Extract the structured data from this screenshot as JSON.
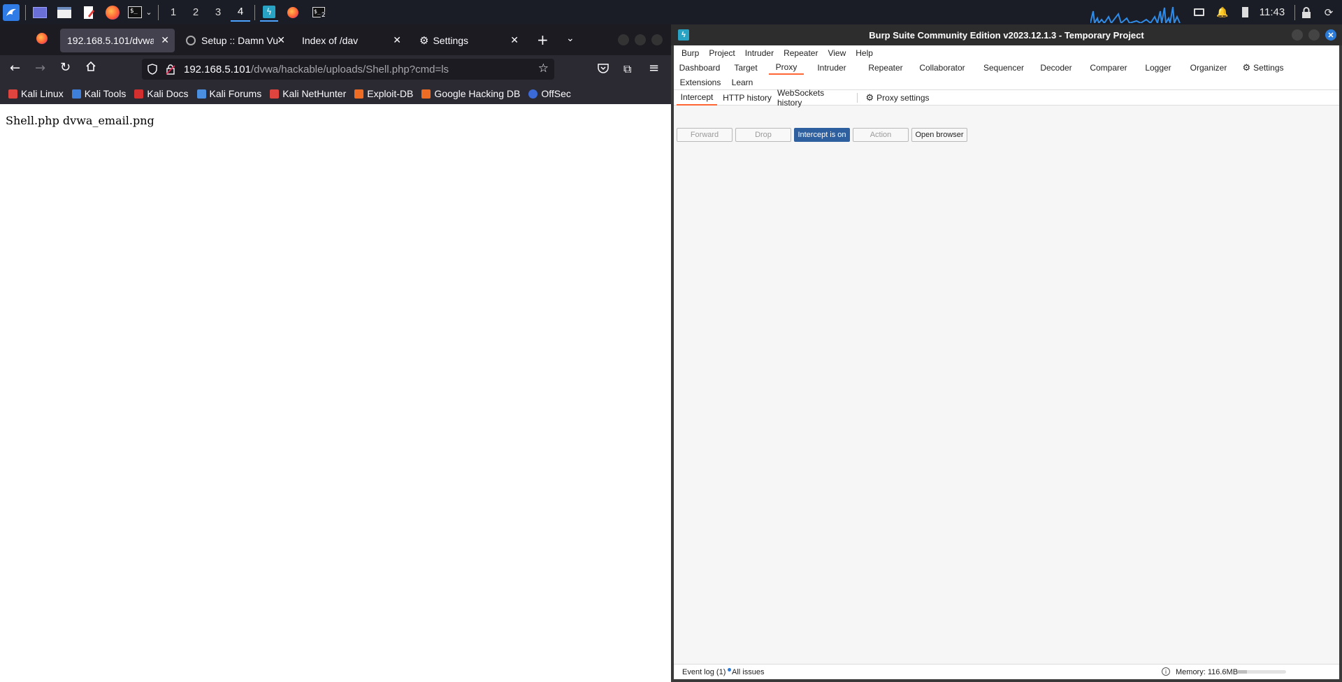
{
  "taskbar": {
    "workspaces": [
      "1",
      "2",
      "3",
      "4"
    ],
    "active_workspace": "4",
    "clock": "11:43",
    "terminal_badge": "2"
  },
  "firefox": {
    "tabs": [
      {
        "label": "192.168.5.101/dvwa/"
      },
      {
        "label": "Setup :: Damn Vu"
      },
      {
        "label": "Index of /dav"
      },
      {
        "label": "Settings"
      }
    ],
    "url": {
      "host": "192.168.5.101",
      "path": "/dvwa/hackable/uploads/Shell.php?cmd=ls"
    },
    "bookmarks": [
      {
        "label": "Kali Linux",
        "color": "#e0443e"
      },
      {
        "label": "Kali Tools",
        "color": "#3f7fdc"
      },
      {
        "label": "Kali Docs",
        "color": "#d32f2f"
      },
      {
        "label": "Kali Forums",
        "color": "#4a8fe0"
      },
      {
        "label": "Kali NetHunter",
        "color": "#e0443e"
      },
      {
        "label": "Exploit-DB",
        "color": "#ef6c25"
      },
      {
        "label": "Google Hacking DB",
        "color": "#ef6c25"
      },
      {
        "label": "OffSec",
        "color": "#3a6bd8"
      }
    ],
    "page_text": "Shell.php dvwa_email.png"
  },
  "burp": {
    "title": "Burp Suite Community Edition v2023.12.1.3 - Temporary Project",
    "menu": [
      "Burp",
      "Project",
      "Intruder",
      "Repeater",
      "View",
      "Help"
    ],
    "tools_row1": [
      "Dashboard",
      "Target",
      "Proxy",
      "Intruder",
      "Repeater",
      "Collaborator",
      "Sequencer",
      "Decoder",
      "Comparer",
      "Logger",
      "Organizer",
      "Settings"
    ],
    "tools_row2": [
      "Extensions",
      "Learn"
    ],
    "active_tool": "Proxy",
    "subtabs": [
      "Intercept",
      "HTTP history",
      "WebSockets history",
      "Proxy settings"
    ],
    "active_subtab": "Intercept",
    "buttons": {
      "forward": "Forward",
      "drop": "Drop",
      "intercept": "Intercept is on",
      "action": "Action",
      "open_browser": "Open browser"
    },
    "status": {
      "event_log": "Event log (1)",
      "all_issues": "All issues",
      "memory": "Memory: 116.6MB",
      "memory_fraction": 0.2
    },
    "accent_color": "#ff6633",
    "intercept_on_color": "#2e5f9e"
  }
}
